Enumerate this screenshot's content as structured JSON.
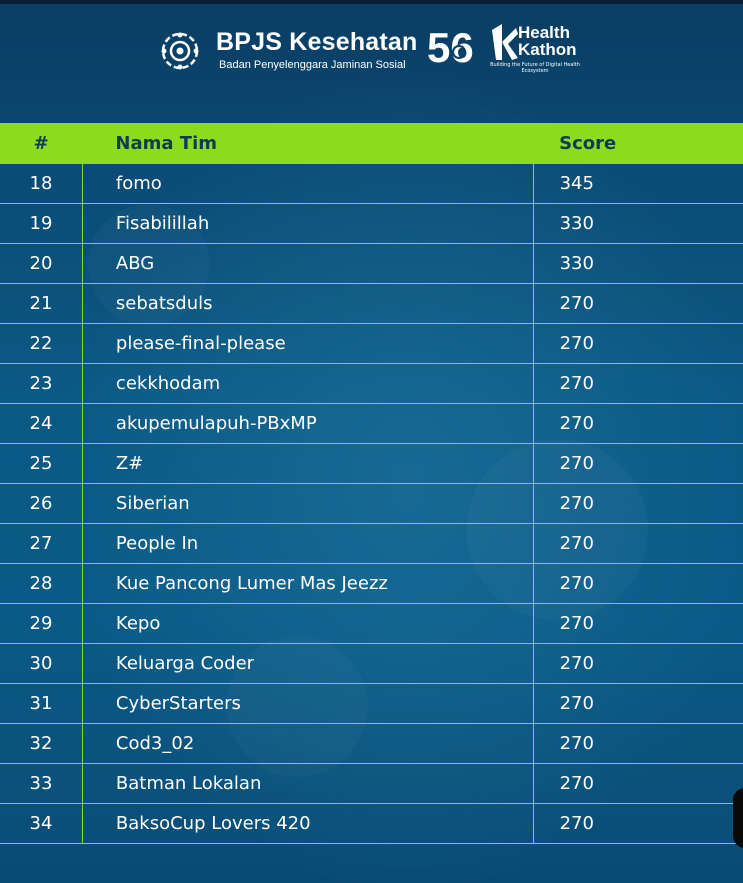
{
  "header": {
    "bpjs_name": "BPJS Kesehatan",
    "bpjs_subtitle": "Badan Penyelenggara Jaminan Sosial",
    "anniversary_number": "56",
    "healthkathon_line1": "Health",
    "healthkathon_line2": "Kathon",
    "healthkathon_tagline": "Building the Future of Digital Health Ecosystem",
    "accent_color": "#8cdc1e"
  },
  "table": {
    "columns": [
      "#",
      "Nama Tim",
      "Score"
    ],
    "rows": [
      {
        "rank": "18",
        "team": "fomo",
        "score": "345"
      },
      {
        "rank": "19",
        "team": "Fisabilillah",
        "score": "330"
      },
      {
        "rank": "20",
        "team": "ABG",
        "score": "330"
      },
      {
        "rank": "21",
        "team": "sebatsduls",
        "score": "270"
      },
      {
        "rank": "22",
        "team": "please-final-please",
        "score": "270"
      },
      {
        "rank": "23",
        "team": "cekkhodam",
        "score": "270"
      },
      {
        "rank": "24",
        "team": "akupemulapuh-PBxMP",
        "score": "270"
      },
      {
        "rank": "25",
        "team": "Z#",
        "score": "270"
      },
      {
        "rank": "26",
        "team": "Siberian",
        "score": "270"
      },
      {
        "rank": "27",
        "team": "People In",
        "score": "270"
      },
      {
        "rank": "28",
        "team": "Kue Pancong Lumer Mas Jeezz",
        "score": "270"
      },
      {
        "rank": "29",
        "team": "Kepo",
        "score": "270"
      },
      {
        "rank": "30",
        "team": "Keluarga Coder",
        "score": "270"
      },
      {
        "rank": "31",
        "team": "CyberStarters",
        "score": "270"
      },
      {
        "rank": "32",
        "team": "Cod3_02",
        "score": "270"
      },
      {
        "rank": "33",
        "team": "Batman Lokalan",
        "score": "270"
      },
      {
        "rank": "34",
        "team": "BaksoCup Lovers 420",
        "score": "270"
      }
    ]
  }
}
